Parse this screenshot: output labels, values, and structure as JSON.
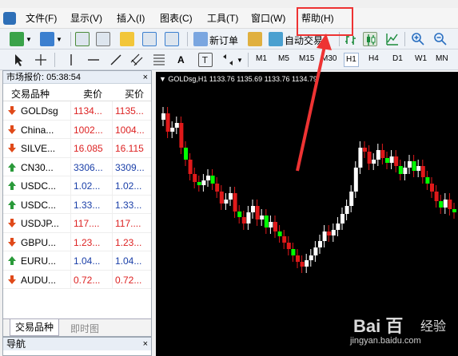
{
  "menu": {
    "items": [
      "文件(F)",
      "显示(V)",
      "插入(I)",
      "图表(C)",
      "工具(T)",
      "窗口(W)",
      "帮助(H)"
    ]
  },
  "toolbar": {
    "new_order_label": "新订单",
    "auto_trade_label": "自动交易",
    "timeframes": [
      "M1",
      "M5",
      "M15",
      "M30",
      "H1",
      "H4",
      "D1",
      "W1",
      "MN"
    ],
    "active_timeframe": "H1",
    "text_tool_label": "A"
  },
  "market_watch": {
    "title": "市场报价: 05:38:54",
    "columns": [
      "交易品种",
      "卖价",
      "买价"
    ],
    "rows": [
      {
        "symbol": "GOLDsg",
        "bid": "1134...",
        "ask": "1135...",
        "direction": "down",
        "color": "#d22"
      },
      {
        "symbol": "China...",
        "bid": "1002...",
        "ask": "1004...",
        "direction": "down",
        "color": "#d22"
      },
      {
        "symbol": "SILVE...",
        "bid": "16.085",
        "ask": "16.115",
        "direction": "down",
        "color": "#d22"
      },
      {
        "symbol": "CN30...",
        "bid": "3306...",
        "ask": "3309...",
        "direction": "up",
        "color": "#1a3fa8"
      },
      {
        "symbol": "USDC...",
        "bid": "1.02...",
        "ask": "1.02...",
        "direction": "up",
        "color": "#1a3fa8"
      },
      {
        "symbol": "USDC...",
        "bid": "1.33...",
        "ask": "1.33...",
        "direction": "up",
        "color": "#1a3fa8"
      },
      {
        "symbol": "USDJP...",
        "bid": "117....",
        "ask": "117....",
        "direction": "down",
        "color": "#d22"
      },
      {
        "symbol": "GBPU...",
        "bid": "1.23...",
        "ask": "1.23...",
        "direction": "down",
        "color": "#d22"
      },
      {
        "symbol": "EURU...",
        "bid": "1.04...",
        "ask": "1.04...",
        "direction": "up",
        "color": "#1a3fa8"
      },
      {
        "symbol": "AUDU...",
        "bid": "0.72...",
        "ask": "0.72...",
        "direction": "down",
        "color": "#d22"
      }
    ],
    "tabs": [
      "交易品种",
      "即时图"
    ],
    "close_icon": "×"
  },
  "navigator": {
    "title": "导航",
    "close_icon": "×"
  },
  "chart": {
    "info": "▼ GOLDsg,H1  1133.76 1135.69 1133.76 1134.79",
    "background": "#000000",
    "bull_color": "#ffffff",
    "bear_color": "#e0191a",
    "doji_color": "#00ff00"
  },
  "watermark": {
    "logo": "Bai 百",
    "cn": "经验",
    "url": "jingyan.baidu.com"
  }
}
